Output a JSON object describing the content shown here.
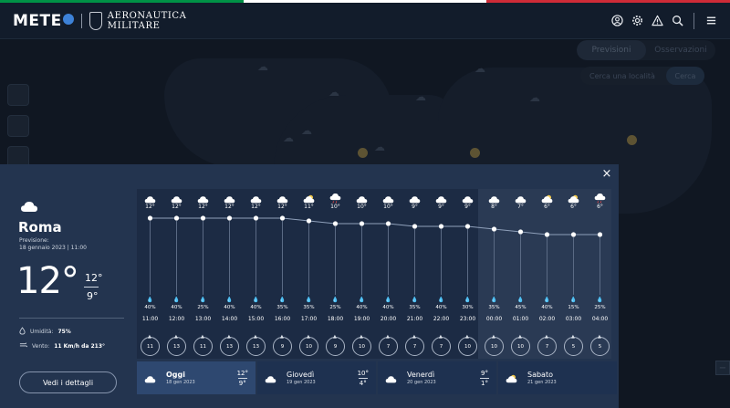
{
  "flag_colors": [
    "#009246",
    "#ffffff",
    "#ce2b37"
  ],
  "header": {
    "logo": "METE",
    "brand": [
      "AERONAUTICA",
      "MILITARE"
    ],
    "icons": [
      "user-icon",
      "gear-icon",
      "alert-icon",
      "search-icon",
      "menu-icon"
    ]
  },
  "map": {
    "tabs": [
      "Previsioni",
      "Osservazioni"
    ],
    "search_placeholder": "Cerca una località",
    "search_button": "Cerca"
  },
  "current": {
    "city": "Roma",
    "forecast_label": "Previsione:",
    "forecast_date": "18 gennaio 2023 | 11:00",
    "temp": "12°",
    "max": "12°",
    "min": "9°",
    "humidity_label": "Umidità:",
    "humidity": "75%",
    "wind_label": "Vento:",
    "wind": "11 Km/h da 213°",
    "details_button": "Vedi i dettagli",
    "close": "×"
  },
  "hourly": [
    {
      "time": "11:00",
      "temp": "12°",
      "rain": "40%",
      "wind": "11",
      "icon": "cloud"
    },
    {
      "time": "12:00",
      "temp": "12°",
      "rain": "40%",
      "wind": "13",
      "icon": "cloud"
    },
    {
      "time": "13:00",
      "temp": "12°",
      "rain": "25%",
      "wind": "11",
      "icon": "cloud"
    },
    {
      "time": "14:00",
      "temp": "12°",
      "rain": "40%",
      "wind": "13",
      "icon": "cloud"
    },
    {
      "time": "15:00",
      "temp": "12°",
      "rain": "40%",
      "wind": "13",
      "icon": "cloud"
    },
    {
      "time": "16:00",
      "temp": "12°",
      "rain": "35%",
      "wind": "9",
      "icon": "cloud"
    },
    {
      "time": "17:00",
      "temp": "11°",
      "rain": "35%",
      "wind": "10",
      "icon": "cloud-sun"
    },
    {
      "time": "18:00",
      "temp": "10°",
      "rain": "25%",
      "wind": "9",
      "icon": "cloud-rain"
    },
    {
      "time": "19:00",
      "temp": "10°",
      "rain": "40%",
      "wind": "10",
      "icon": "cloud"
    },
    {
      "time": "20:00",
      "temp": "10°",
      "rain": "40%",
      "wind": "7",
      "icon": "cloud"
    },
    {
      "time": "21:00",
      "temp": "9°",
      "rain": "35%",
      "wind": "7",
      "icon": "cloud"
    },
    {
      "time": "22:00",
      "temp": "9°",
      "rain": "40%",
      "wind": "7",
      "icon": "cloud"
    },
    {
      "time": "23:00",
      "temp": "9°",
      "rain": "30%",
      "wind": "10",
      "icon": "cloud"
    },
    {
      "time": "00:00",
      "temp": "8°",
      "rain": "35%",
      "wind": "10",
      "icon": "cloud"
    },
    {
      "time": "01:00",
      "temp": "7°",
      "rain": "45%",
      "wind": "10",
      "icon": "cloud"
    },
    {
      "time": "02:00",
      "temp": "6°",
      "rain": "40%",
      "wind": "7",
      "icon": "cloud-sun"
    },
    {
      "time": "03:00",
      "temp": "6°",
      "rain": "15%",
      "wind": "5",
      "icon": "cloud-sun"
    },
    {
      "time": "04:00",
      "temp": "6°",
      "rain": "25%",
      "wind": "5",
      "icon": "cloud-rain"
    }
  ],
  "days": [
    {
      "name": "Oggi",
      "date": "18 gen 2023",
      "max": "12°",
      "min": "9°",
      "icon": "cloud",
      "active": true
    },
    {
      "name": "Giovedì",
      "date": "19 gen 2023",
      "max": "10°",
      "min": "4°",
      "icon": "cloud",
      "active": false
    },
    {
      "name": "Venerdì",
      "date": "20 gen 2023",
      "max": "9°",
      "min": "1°",
      "icon": "cloud",
      "active": false
    },
    {
      "name": "Sabato",
      "date": "21 gen 2023",
      "max": "",
      "min": "",
      "icon": "cloud-sun",
      "active": false
    }
  ]
}
